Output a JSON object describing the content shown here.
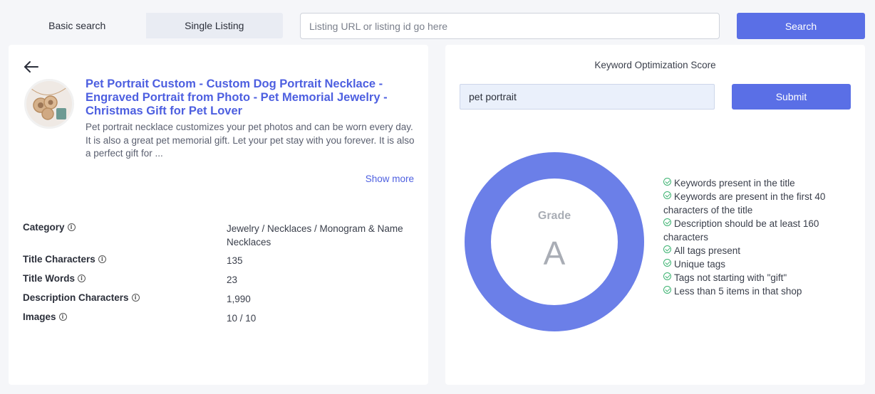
{
  "tabs": [
    {
      "label": "Basic search"
    },
    {
      "label": "Single Listing"
    }
  ],
  "search": {
    "placeholder": "Listing URL or listing id go here",
    "value": "",
    "button_label": "Search"
  },
  "listing": {
    "title": "Pet Portrait Custom - Custom Dog Portrait Necklace - Engraved Portrait from Photo - Pet Memorial Jewelry - Christmas Gift for Pet Lover",
    "description": "Pet portrait necklace customizes your pet photos and can be worn every day. It is also a great pet memorial gift. Let your pet stay with you forever. It is also a perfect gift for ...",
    "show_more": "Show more",
    "details": [
      {
        "label": "Category",
        "value": "Jewelry / Necklaces / Monogram & Name Necklaces"
      },
      {
        "label": "Title Characters",
        "value": "135"
      },
      {
        "label": "Title Words",
        "value": "23"
      },
      {
        "label": "Description Characters",
        "value": "1,990"
      },
      {
        "label": "Images",
        "value": "10 / 10"
      }
    ]
  },
  "score": {
    "title": "Keyword Optimization Score",
    "keyword_value": "pet portrait",
    "submit_label": "Submit",
    "grade_label": "Grade",
    "grade": "A",
    "ring_color": "#6b7fe8",
    "check_color": "#3cb371",
    "accent": "#5a6fe6",
    "checks": [
      "Keywords present in the title",
      "Keywords are present in the first 40 characters of the title",
      "Description should be at least 160 characters",
      "All tags present",
      "Unique tags",
      "Tags not starting with \"gift\"",
      "Less than 5 items in that shop"
    ]
  }
}
